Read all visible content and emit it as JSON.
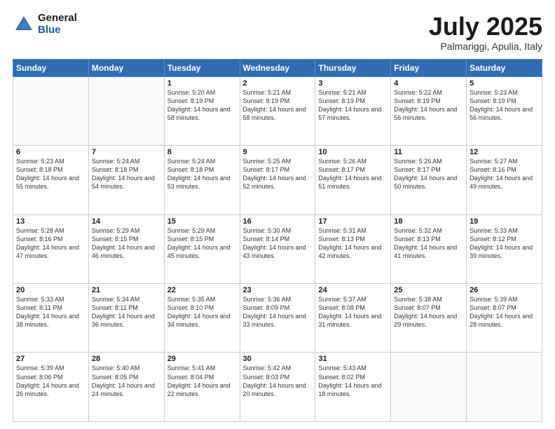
{
  "header": {
    "logo_general": "General",
    "logo_blue": "Blue",
    "month_title": "July 2025",
    "location": "Palmariggi, Apulia, Italy"
  },
  "weekdays": [
    "Sunday",
    "Monday",
    "Tuesday",
    "Wednesday",
    "Thursday",
    "Friday",
    "Saturday"
  ],
  "weeks": [
    [
      {
        "day": "",
        "sunrise": "",
        "sunset": "",
        "daylight": ""
      },
      {
        "day": "",
        "sunrise": "",
        "sunset": "",
        "daylight": ""
      },
      {
        "day": "1",
        "sunrise": "Sunrise: 5:20 AM",
        "sunset": "Sunset: 8:19 PM",
        "daylight": "Daylight: 14 hours and 58 minutes."
      },
      {
        "day": "2",
        "sunrise": "Sunrise: 5:21 AM",
        "sunset": "Sunset: 8:19 PM",
        "daylight": "Daylight: 14 hours and 58 minutes."
      },
      {
        "day": "3",
        "sunrise": "Sunrise: 5:21 AM",
        "sunset": "Sunset: 8:19 PM",
        "daylight": "Daylight: 14 hours and 57 minutes."
      },
      {
        "day": "4",
        "sunrise": "Sunrise: 5:22 AM",
        "sunset": "Sunset: 8:19 PM",
        "daylight": "Daylight: 14 hours and 56 minutes."
      },
      {
        "day": "5",
        "sunrise": "Sunrise: 5:23 AM",
        "sunset": "Sunset: 8:19 PM",
        "daylight": "Daylight: 14 hours and 56 minutes."
      }
    ],
    [
      {
        "day": "6",
        "sunrise": "Sunrise: 5:23 AM",
        "sunset": "Sunset: 8:18 PM",
        "daylight": "Daylight: 14 hours and 55 minutes."
      },
      {
        "day": "7",
        "sunrise": "Sunrise: 5:24 AM",
        "sunset": "Sunset: 8:18 PM",
        "daylight": "Daylight: 14 hours and 54 minutes."
      },
      {
        "day": "8",
        "sunrise": "Sunrise: 5:24 AM",
        "sunset": "Sunset: 8:18 PM",
        "daylight": "Daylight: 14 hours and 53 minutes."
      },
      {
        "day": "9",
        "sunrise": "Sunrise: 5:25 AM",
        "sunset": "Sunset: 8:17 PM",
        "daylight": "Daylight: 14 hours and 52 minutes."
      },
      {
        "day": "10",
        "sunrise": "Sunrise: 5:26 AM",
        "sunset": "Sunset: 8:17 PM",
        "daylight": "Daylight: 14 hours and 51 minutes."
      },
      {
        "day": "11",
        "sunrise": "Sunrise: 5:26 AM",
        "sunset": "Sunset: 8:17 PM",
        "daylight": "Daylight: 14 hours and 50 minutes."
      },
      {
        "day": "12",
        "sunrise": "Sunrise: 5:27 AM",
        "sunset": "Sunset: 8:16 PM",
        "daylight": "Daylight: 14 hours and 49 minutes."
      }
    ],
    [
      {
        "day": "13",
        "sunrise": "Sunrise: 5:28 AM",
        "sunset": "Sunset: 8:16 PM",
        "daylight": "Daylight: 14 hours and 47 minutes."
      },
      {
        "day": "14",
        "sunrise": "Sunrise: 5:29 AM",
        "sunset": "Sunset: 8:15 PM",
        "daylight": "Daylight: 14 hours and 46 minutes."
      },
      {
        "day": "15",
        "sunrise": "Sunrise: 5:29 AM",
        "sunset": "Sunset: 8:15 PM",
        "daylight": "Daylight: 14 hours and 45 minutes."
      },
      {
        "day": "16",
        "sunrise": "Sunrise: 5:30 AM",
        "sunset": "Sunset: 8:14 PM",
        "daylight": "Daylight: 14 hours and 43 minutes."
      },
      {
        "day": "17",
        "sunrise": "Sunrise: 5:31 AM",
        "sunset": "Sunset: 8:13 PM",
        "daylight": "Daylight: 14 hours and 42 minutes."
      },
      {
        "day": "18",
        "sunrise": "Sunrise: 5:32 AM",
        "sunset": "Sunset: 8:13 PM",
        "daylight": "Daylight: 14 hours and 41 minutes."
      },
      {
        "day": "19",
        "sunrise": "Sunrise: 5:33 AM",
        "sunset": "Sunset: 8:12 PM",
        "daylight": "Daylight: 14 hours and 39 minutes."
      }
    ],
    [
      {
        "day": "20",
        "sunrise": "Sunrise: 5:33 AM",
        "sunset": "Sunset: 8:11 PM",
        "daylight": "Daylight: 14 hours and 38 minutes."
      },
      {
        "day": "21",
        "sunrise": "Sunrise: 5:34 AM",
        "sunset": "Sunset: 8:11 PM",
        "daylight": "Daylight: 14 hours and 36 minutes."
      },
      {
        "day": "22",
        "sunrise": "Sunrise: 5:35 AM",
        "sunset": "Sunset: 8:10 PM",
        "daylight": "Daylight: 14 hours and 34 minutes."
      },
      {
        "day": "23",
        "sunrise": "Sunrise: 5:36 AM",
        "sunset": "Sunset: 8:09 PM",
        "daylight": "Daylight: 14 hours and 33 minutes."
      },
      {
        "day": "24",
        "sunrise": "Sunrise: 5:37 AM",
        "sunset": "Sunset: 8:08 PM",
        "daylight": "Daylight: 14 hours and 31 minutes."
      },
      {
        "day": "25",
        "sunrise": "Sunrise: 5:38 AM",
        "sunset": "Sunset: 8:07 PM",
        "daylight": "Daylight: 14 hours and 29 minutes."
      },
      {
        "day": "26",
        "sunrise": "Sunrise: 5:39 AM",
        "sunset": "Sunset: 8:07 PM",
        "daylight": "Daylight: 14 hours and 28 minutes."
      }
    ],
    [
      {
        "day": "27",
        "sunrise": "Sunrise: 5:39 AM",
        "sunset": "Sunset: 8:06 PM",
        "daylight": "Daylight: 14 hours and 26 minutes."
      },
      {
        "day": "28",
        "sunrise": "Sunrise: 5:40 AM",
        "sunset": "Sunset: 8:05 PM",
        "daylight": "Daylight: 14 hours and 24 minutes."
      },
      {
        "day": "29",
        "sunrise": "Sunrise: 5:41 AM",
        "sunset": "Sunset: 8:04 PM",
        "daylight": "Daylight: 14 hours and 22 minutes."
      },
      {
        "day": "30",
        "sunrise": "Sunrise: 5:42 AM",
        "sunset": "Sunset: 8:03 PM",
        "daylight": "Daylight: 14 hours and 20 minutes."
      },
      {
        "day": "31",
        "sunrise": "Sunrise: 5:43 AM",
        "sunset": "Sunset: 8:02 PM",
        "daylight": "Daylight: 14 hours and 18 minutes."
      },
      {
        "day": "",
        "sunrise": "",
        "sunset": "",
        "daylight": ""
      },
      {
        "day": "",
        "sunrise": "",
        "sunset": "",
        "daylight": ""
      }
    ]
  ]
}
